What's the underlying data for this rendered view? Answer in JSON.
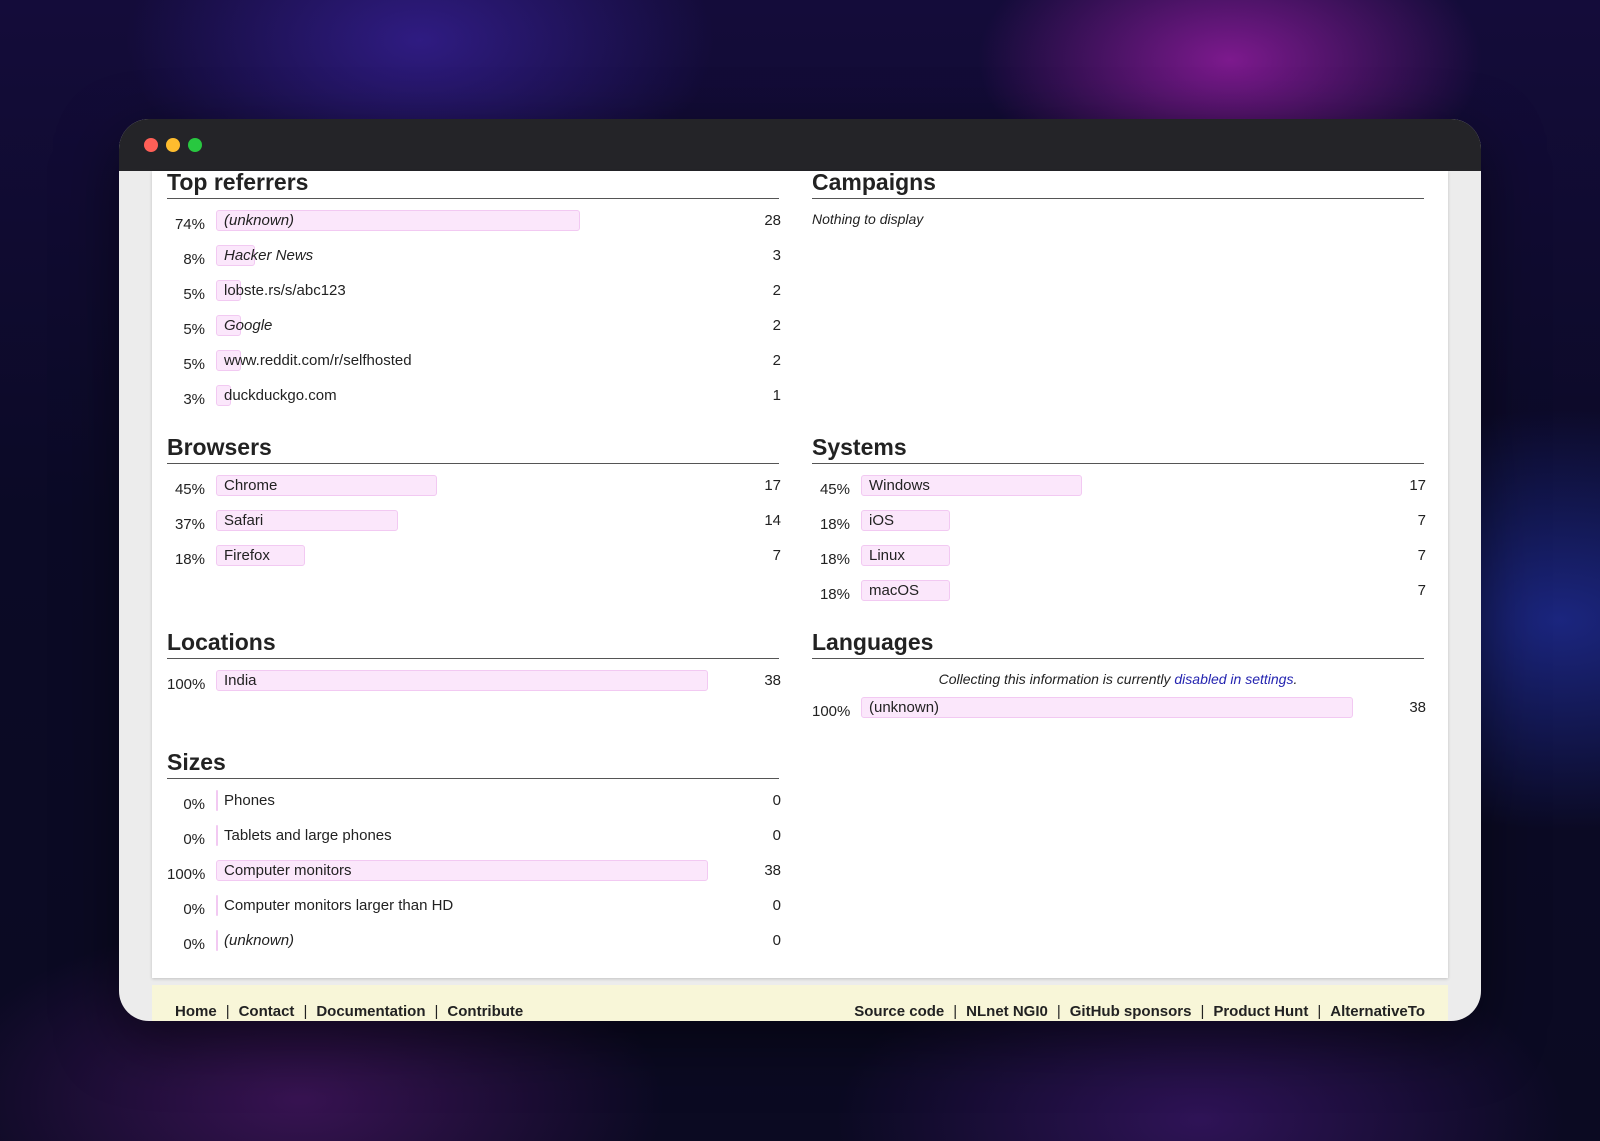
{
  "sections": {
    "referrers": {
      "title": "Top referrers",
      "rows": [
        {
          "pct": "74%",
          "label": "(unknown)",
          "count": "28",
          "fraction": 0.74
        },
        {
          "pct": "8%",
          "label": "Hacker News",
          "count": "3",
          "fraction": 0.08
        },
        {
          "pct": "5%",
          "label": "lobste.rs/s/abc123",
          "count": "2",
          "fraction": 0.05
        },
        {
          "pct": "5%",
          "label": "Google",
          "count": "2",
          "fraction": 0.05
        },
        {
          "pct": "5%",
          "label": "www.reddit.com/r/selfhosted",
          "count": "2",
          "fraction": 0.05
        },
        {
          "pct": "3%",
          "label": "duckduckgo.com",
          "count": "1",
          "fraction": 0.03
        }
      ]
    },
    "campaigns": {
      "title": "Campaigns",
      "empty_text": "Nothing to display"
    },
    "browsers": {
      "title": "Browsers",
      "rows": [
        {
          "pct": "45%",
          "label": "Chrome",
          "count": "17",
          "fraction": 0.45
        },
        {
          "pct": "37%",
          "label": "Safari",
          "count": "14",
          "fraction": 0.37
        },
        {
          "pct": "18%",
          "label": "Firefox",
          "count": "7",
          "fraction": 0.18
        }
      ]
    },
    "systems": {
      "title": "Systems",
      "rows": [
        {
          "pct": "45%",
          "label": "Windows",
          "count": "17",
          "fraction": 0.45
        },
        {
          "pct": "18%",
          "label": "iOS",
          "count": "7",
          "fraction": 0.18
        },
        {
          "pct": "18%",
          "label": "Linux",
          "count": "7",
          "fraction": 0.18
        },
        {
          "pct": "18%",
          "label": "macOS",
          "count": "7",
          "fraction": 0.18
        }
      ]
    },
    "locations": {
      "title": "Locations",
      "rows": [
        {
          "pct": "100%",
          "label": "India",
          "count": "38",
          "fraction": 1.0
        }
      ]
    },
    "languages": {
      "title": "Languages",
      "notice_prefix": "Collecting this information is currently ",
      "notice_link": "disabled in settings",
      "notice_suffix": ".",
      "rows": [
        {
          "pct": "100%",
          "label": "(unknown)",
          "count": "38",
          "fraction": 1.0
        }
      ]
    },
    "sizes": {
      "title": "Sizes",
      "rows": [
        {
          "pct": "0%",
          "label": "Phones",
          "count": "0",
          "fraction": 0
        },
        {
          "pct": "0%",
          "label": "Tablets and large phones",
          "count": "0",
          "fraction": 0
        },
        {
          "pct": "100%",
          "label": "Computer monitors",
          "count": "38",
          "fraction": 1.0
        },
        {
          "pct": "0%",
          "label": "Computer monitors larger than HD",
          "count": "0",
          "fraction": 0
        },
        {
          "pct": "0%",
          "label": "(unknown)",
          "count": "0",
          "fraction": 0
        }
      ]
    }
  },
  "footer": {
    "left": [
      "Home",
      "Contact",
      "Documentation",
      "Contribute"
    ],
    "right": [
      "Source code",
      "NLnet NGI0",
      "GitHub sponsors",
      "Product Hunt",
      "AlternativeTo"
    ],
    "separator": "|"
  },
  "colors": {
    "bar_fill": "#fbe7fb",
    "bar_border": "#f2c9f2",
    "link": "#2424b0",
    "footer_bg": "#f8f6d8",
    "titlebar": "#242428"
  }
}
